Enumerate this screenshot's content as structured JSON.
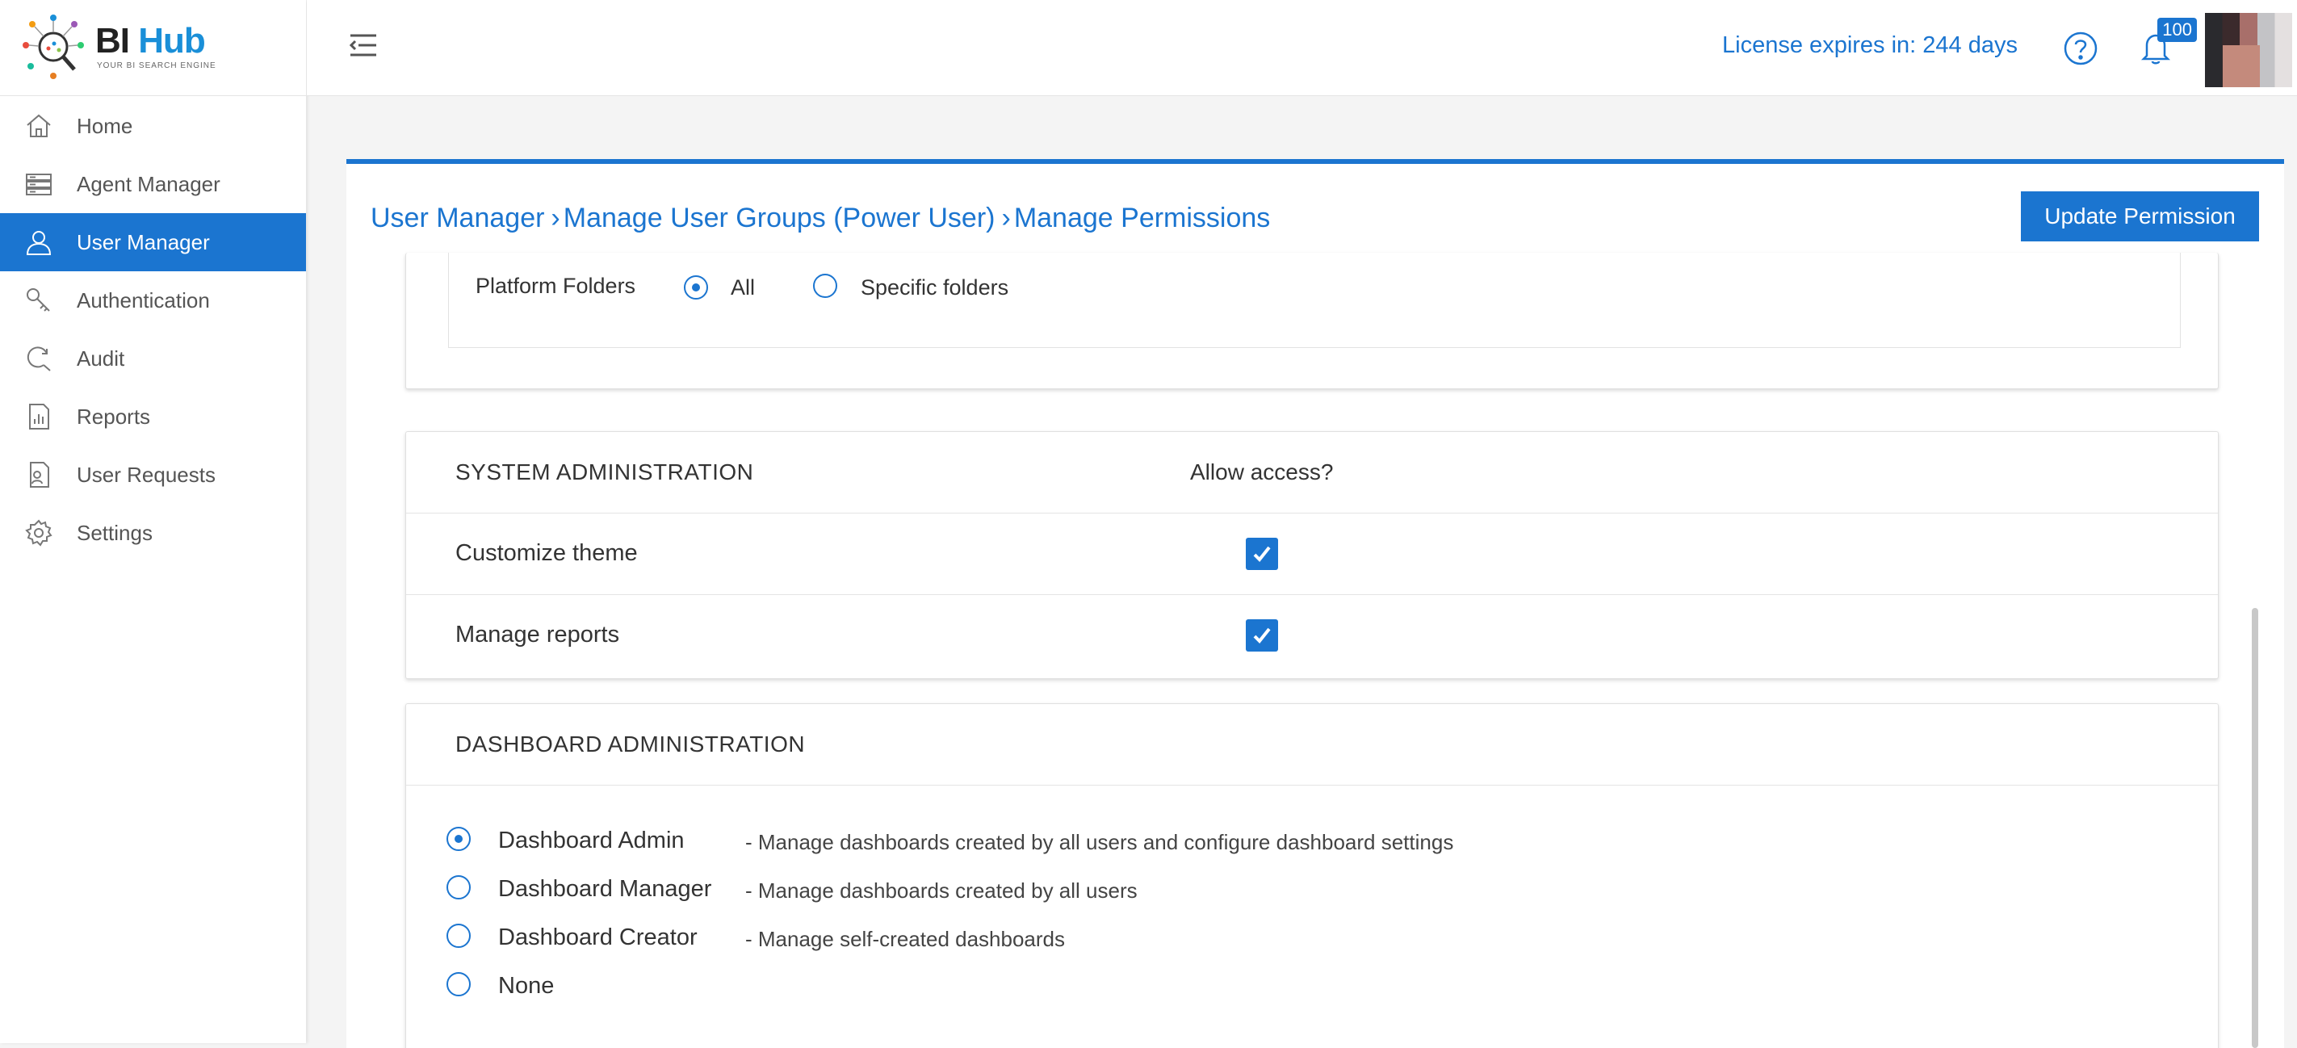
{
  "brand": {
    "name_part1": "BI",
    "name_part2": "Hub",
    "tagline": "YOUR BI SEARCH ENGINE"
  },
  "sidebar": {
    "items": [
      {
        "label": "Home",
        "icon": "home-icon"
      },
      {
        "label": "Agent Manager",
        "icon": "server-icon"
      },
      {
        "label": "User Manager",
        "icon": "user-icon",
        "active": true
      },
      {
        "label": "Authentication",
        "icon": "key-icon"
      },
      {
        "label": "Audit",
        "icon": "audit-search-icon"
      },
      {
        "label": "Reports",
        "icon": "report-icon"
      },
      {
        "label": "User Requests",
        "icon": "request-icon"
      },
      {
        "label": "Settings",
        "icon": "gear-icon"
      }
    ]
  },
  "header": {
    "license_text": "License expires in: 244 days",
    "notifications_count": "100"
  },
  "breadcrumb": {
    "level1": "User Manager",
    "level2": "Manage User Groups  (Power User)",
    "level3": "Manage Permissions"
  },
  "actions": {
    "update_label": "Update Permission"
  },
  "platform_folders": {
    "label": "Platform Folders",
    "options": [
      {
        "label": "All",
        "checked": true
      },
      {
        "label": "Specific folders",
        "checked": false
      }
    ]
  },
  "system_admin": {
    "title": "SYSTEM ADMINISTRATION",
    "column_header": "Allow access?",
    "rows": [
      {
        "label": "Customize theme",
        "checked": true
      },
      {
        "label": "Manage reports",
        "checked": true
      }
    ]
  },
  "dashboard_admin": {
    "title": "DASHBOARD ADMINISTRATION",
    "options": [
      {
        "name": "Dashboard Admin",
        "description": "- Manage dashboards created by all users and configure dashboard settings",
        "checked": true
      },
      {
        "name": "Dashboard Manager",
        "description": "- Manage dashboards created by all users",
        "checked": false
      },
      {
        "name": "Dashboard Creator",
        "description": "- Manage self-created dashboards",
        "checked": false
      },
      {
        "name": "None",
        "description": "",
        "checked": false
      }
    ]
  },
  "colors": {
    "accent": "#1b75d0",
    "brand_hub": "#1a8fd8"
  }
}
